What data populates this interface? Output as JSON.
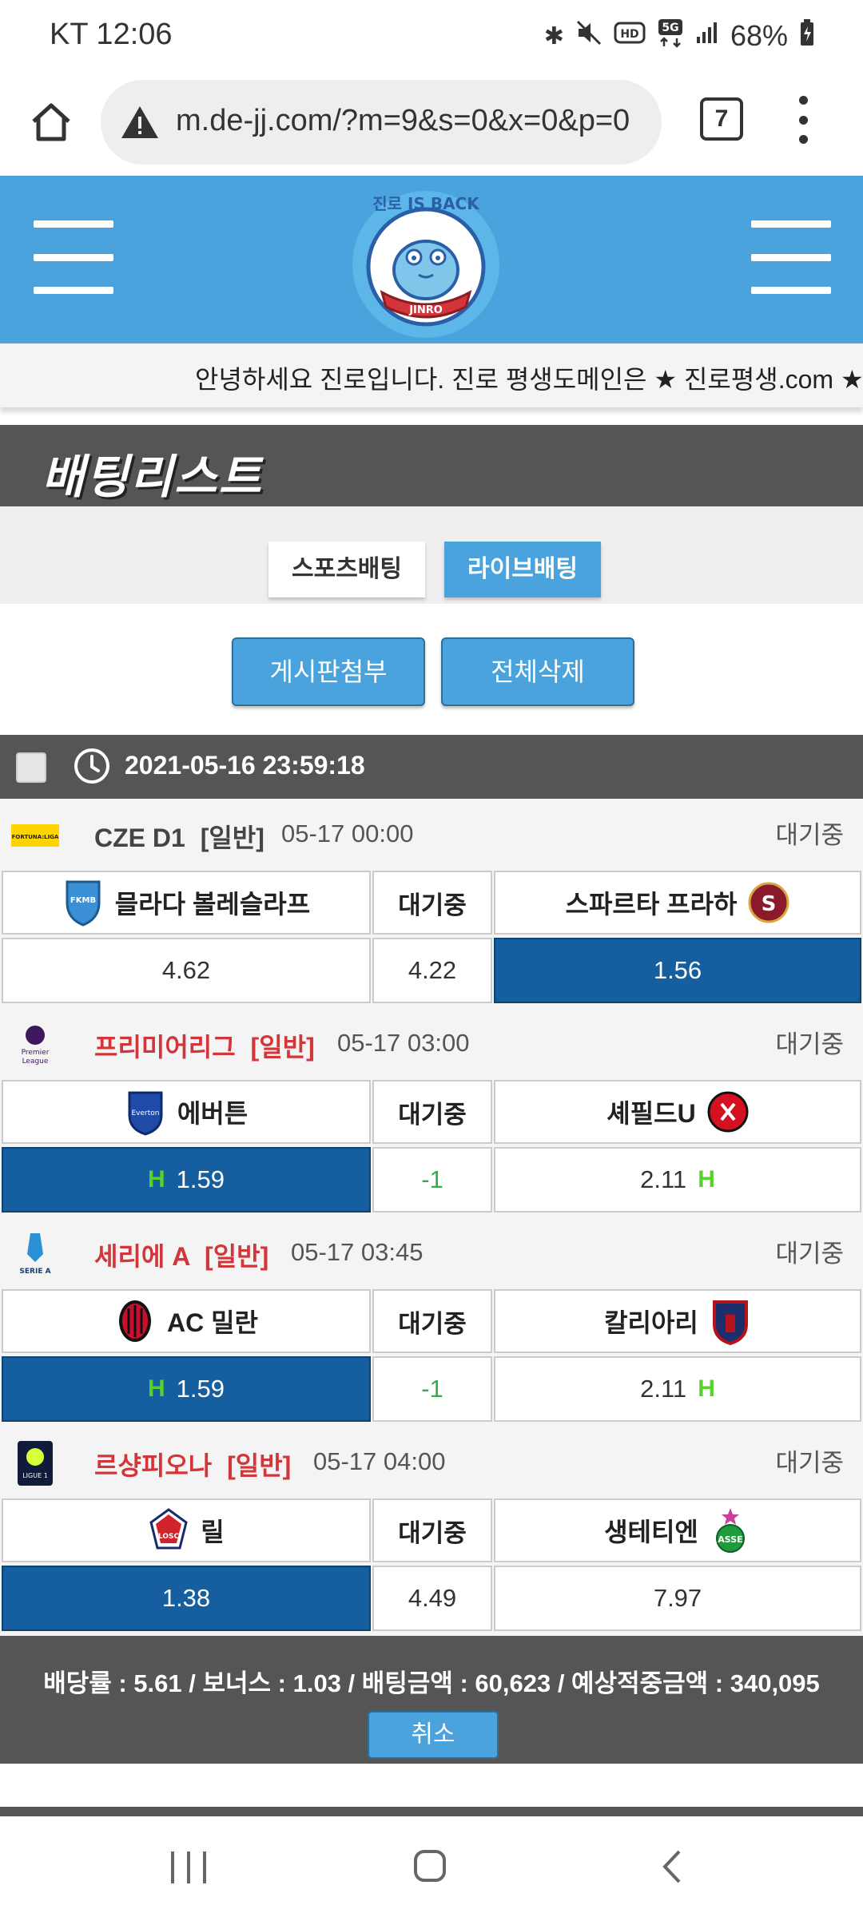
{
  "status_bar": {
    "carrier_time": "KT 12:06",
    "battery": "68%",
    "icons": [
      "bluetooth-icon",
      "mute-icon",
      "hd-icon",
      "5g-icon",
      "signal-icon",
      "battery-icon"
    ]
  },
  "browser": {
    "url": "m.de-jj.com/?m=9&s=0&x=0&p=0",
    "tab_count": "7"
  },
  "site": {
    "logo_alt": "JINRO IS BACK",
    "ticker": "안녕하세요 진로입니다. 진로 평생도메인은 ★ 진로평생.com ★"
  },
  "page": {
    "title": "배팅리스트",
    "tabs": [
      {
        "label": "스포츠배팅",
        "active": false
      },
      {
        "label": "라이브배팅",
        "active": true
      }
    ],
    "actions": {
      "attach": "게시판첨부",
      "delete_all": "전체삭제"
    }
  },
  "bet_list": {
    "timestamp": "2021-05-16 23:59:18",
    "matches": [
      {
        "league": "CZE D1",
        "tag": "[일반]",
        "time": "05-17 00:00",
        "status": "대기중",
        "home": "믈라다 볼레슬라프",
        "mid_label": "대기중",
        "away": "스파르타 프라하",
        "odds_home": "4.62",
        "odds_mid": "4.22",
        "odds_away": "1.56",
        "selected": "away"
      },
      {
        "league": "프리미어리그",
        "tag": "[일반]",
        "time": "05-17 03:00",
        "status": "대기중",
        "home": "에버튼",
        "mid_label": "대기중",
        "away": "셰필드U",
        "odds_home": "1.59",
        "odds_mid": "-1",
        "odds_away": "2.11",
        "handicap_mark": "H",
        "selected": "home"
      },
      {
        "league": "세리에 A",
        "tag": "[일반]",
        "time": "05-17 03:45",
        "status": "대기중",
        "home": "AC 밀란",
        "mid_label": "대기중",
        "away": "칼리아리",
        "odds_home": "1.59",
        "odds_mid": "-1",
        "odds_away": "2.11",
        "handicap_mark": "H",
        "selected": "home"
      },
      {
        "league": "르샹피오나",
        "tag": "[일반]",
        "time": "05-17 04:00",
        "status": "대기중",
        "home": "릴",
        "mid_label": "대기중",
        "away": "생테티엔",
        "odds_home": "1.38",
        "odds_mid": "4.49",
        "odds_away": "7.97",
        "selected": "home"
      }
    ]
  },
  "summary": {
    "text": "배당률 : 5.61 / 보너스 : 1.03 / 배팅금액 : 60,623 / 예상적중금액 : 340,095",
    "cancel": "취소"
  },
  "colors": {
    "header_blue": "#4aa3dc",
    "selected_blue": "#155e9f",
    "dark_band": "#555555",
    "league_red": "#d2353a",
    "handicap_green": "#57d12c"
  }
}
